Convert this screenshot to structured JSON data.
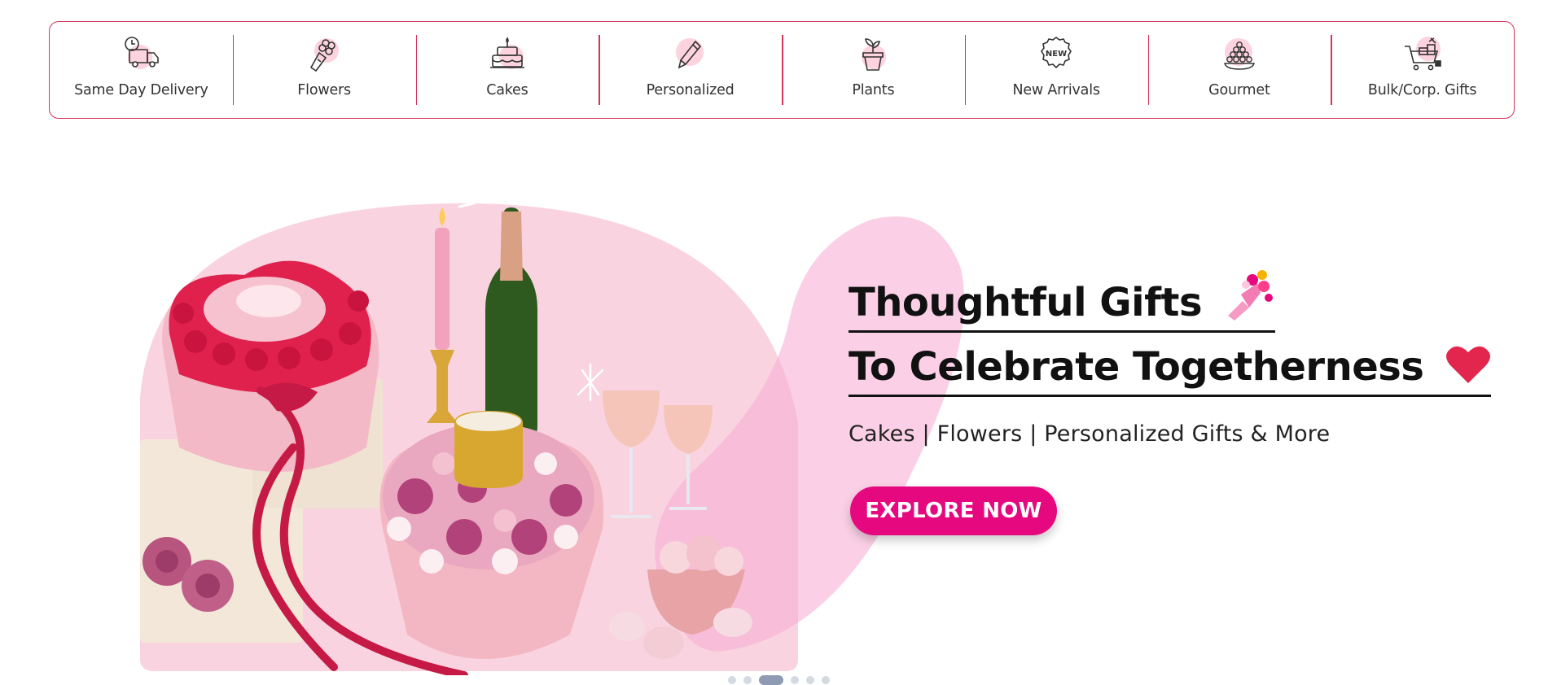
{
  "categories": [
    {
      "label": "Same Day Delivery",
      "icon": "delivery-truck-icon"
    },
    {
      "label": "Flowers",
      "icon": "bouquet-icon"
    },
    {
      "label": "Cakes",
      "icon": "cake-icon"
    },
    {
      "label": "Personalized",
      "icon": "pencil-icon"
    },
    {
      "label": "Plants",
      "icon": "potted-plant-icon"
    },
    {
      "label": "New Arrivals",
      "icon": "new-badge-icon"
    },
    {
      "label": "Gourmet",
      "icon": "sweets-bowl-icon"
    },
    {
      "label": "Bulk/Corp. Gifts",
      "icon": "cart-gift-icon"
    }
  ],
  "new_badge_text": "NEW",
  "hero": {
    "title_line1": "Thoughtful Gifts",
    "title_line2": "To Celebrate Togetherness",
    "subtitle": "Cakes | Flowers | Personalized Gifts & More",
    "cta_label": "EXPLORE NOW"
  },
  "carousel": {
    "slide_count": 6,
    "active_index": 2
  },
  "colors": {
    "accent": "#e5087e",
    "border": "#d6335a",
    "icon_blob": "#fcd3de"
  }
}
